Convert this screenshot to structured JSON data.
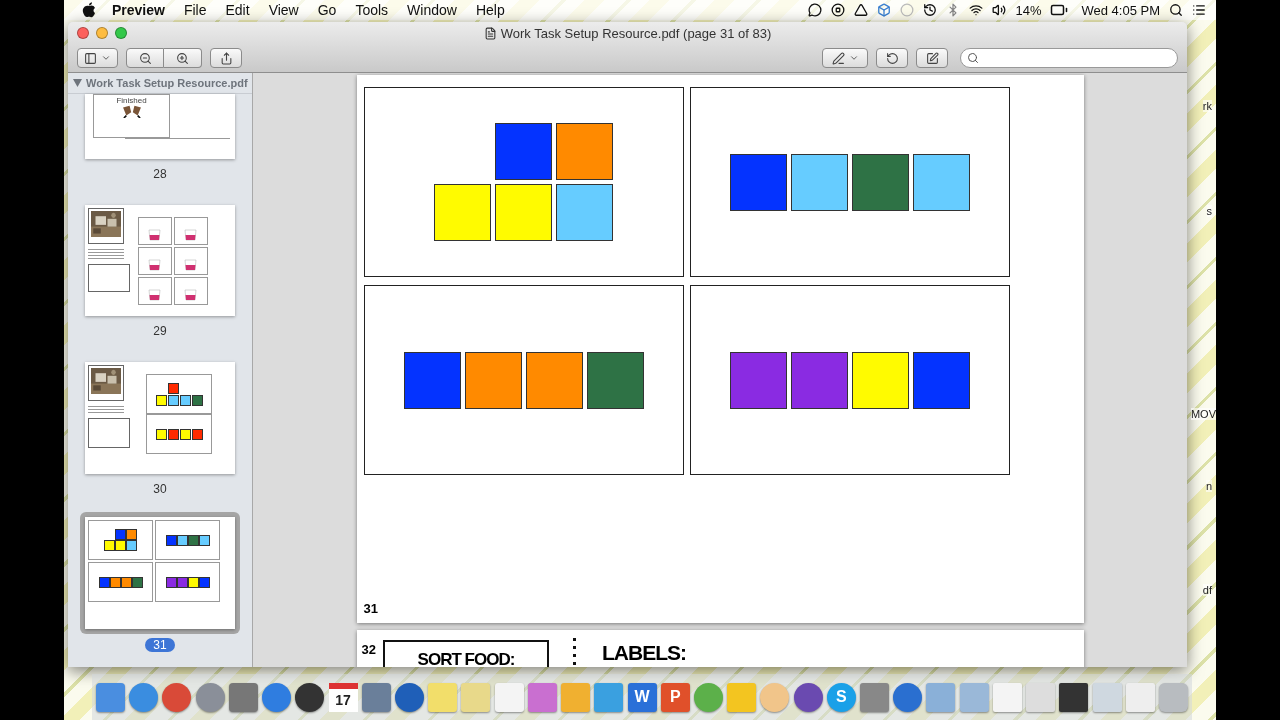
{
  "menu_bar": {
    "app_name": "Preview",
    "menus": [
      "File",
      "Edit",
      "View",
      "Go",
      "Tools",
      "Window",
      "Help"
    ],
    "battery": "14%",
    "clock": "Wed 4:05 PM"
  },
  "window": {
    "title": "Work Task Setup Resource.pdf (page 31 of 83)"
  },
  "sidebar": {
    "header": "Work Task Setup Resource.pdf",
    "expanded": true,
    "thumbnails": [
      {
        "page": "28",
        "selected": false,
        "kind": "finished",
        "caption": "Finished"
      },
      {
        "page": "29",
        "selected": false,
        "kind": "cups"
      },
      {
        "page": "30",
        "selected": false,
        "kind": "lesson",
        "cards": [
          {
            "rows": [
              [
                null,
                {
                  "color": "#ff2a00"
                }
              ],
              [
                {
                  "color": "#fffb00"
                },
                {
                  "color": "#66ccff"
                },
                {
                  "color": "#66ccff"
                },
                {
                  "color": "#2e7245"
                }
              ]
            ]
          },
          {
            "rows": [
              [
                {
                  "color": "#fffb00"
                },
                {
                  "color": "#ff2a00"
                },
                {
                  "color": "#fffb00"
                },
                {
                  "color": "#ff2a00"
                }
              ]
            ]
          }
        ]
      },
      {
        "page": "31",
        "selected": true,
        "kind": "cards",
        "cards": [
          {
            "rows": [
              [
                null,
                {
                  "color": "#0433ff"
                },
                {
                  "color": "#ff8a00"
                }
              ],
              [
                {
                  "color": "#fffb00"
                },
                {
                  "color": "#fffb00"
                },
                {
                  "color": "#66ccff"
                }
              ]
            ]
          },
          {
            "rows": [
              [
                {
                  "color": "#0433ff"
                },
                {
                  "color": "#66ccff"
                },
                {
                  "color": "#2e7245"
                },
                {
                  "color": "#66ccff"
                }
              ]
            ]
          },
          {
            "rows": [
              [
                {
                  "color": "#0433ff"
                },
                {
                  "color": "#ff8a00"
                },
                {
                  "color": "#ff8a00"
                },
                {
                  "color": "#2e7245"
                }
              ]
            ]
          },
          {
            "rows": [
              [
                {
                  "color": "#8a2be2"
                },
                {
                  "color": "#8a2be2"
                },
                {
                  "color": "#fffb00"
                },
                {
                  "color": "#0433ff"
                }
              ]
            ]
          }
        ]
      }
    ]
  },
  "document": {
    "pages": [
      {
        "number": "31",
        "kind": "cards",
        "cards": [
          {
            "rows": [
              [
                null,
                {
                  "color": "#0433ff"
                },
                {
                  "color": "#ff8a00"
                }
              ],
              [
                {
                  "color": "#fffb00"
                },
                {
                  "color": "#fffb00"
                },
                {
                  "color": "#66ccff"
                }
              ]
            ]
          },
          {
            "rows": [
              [
                {
                  "color": "#0433ff"
                },
                {
                  "color": "#66ccff"
                },
                {
                  "color": "#2e7245"
                },
                {
                  "color": "#66ccff"
                }
              ]
            ]
          },
          {
            "rows": [
              [
                {
                  "color": "#0433ff"
                },
                {
                  "color": "#ff8a00"
                },
                {
                  "color": "#ff8a00"
                },
                {
                  "color": "#2e7245"
                }
              ]
            ]
          },
          {
            "rows": [
              [
                {
                  "color": "#8a2be2"
                },
                {
                  "color": "#8a2be2"
                },
                {
                  "color": "#fffb00"
                },
                {
                  "color": "#0433ff"
                }
              ]
            ]
          }
        ]
      },
      {
        "number": "32",
        "kind": "sort",
        "box_title": "SORT FOOD:",
        "labels_title": "LABELS:"
      }
    ]
  },
  "dock": {
    "calendar_date": "17",
    "letters": [
      "W",
      "P",
      "S"
    ]
  },
  "desktop_labels": [
    "rk",
    "s",
    "MOV",
    "n",
    "df"
  ]
}
